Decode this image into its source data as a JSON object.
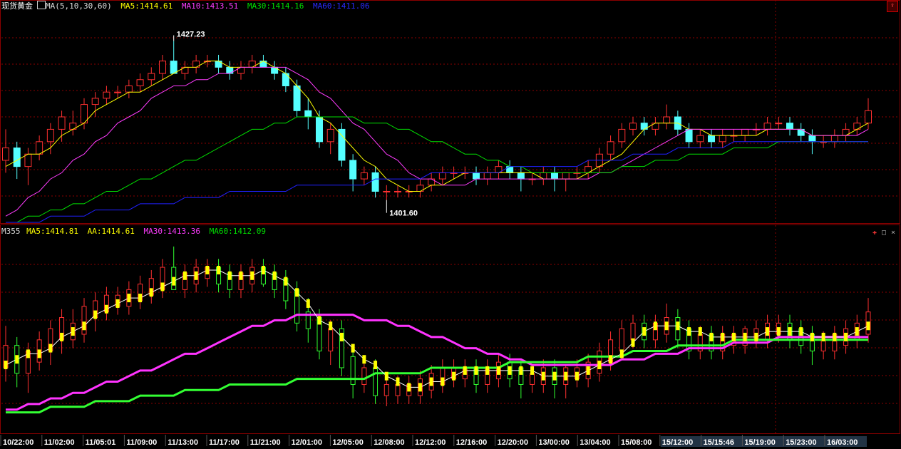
{
  "header_top": {
    "symbol": "现货黄金",
    "indicator": "MA(5,10,30,60)",
    "ma5": "MA5:1414.61",
    "ma10": "MA10:1413.51",
    "ma30": "MA30:1414.16",
    "ma60": "MA60:1411.06"
  },
  "header_bottom": {
    "name": "M355",
    "ma5": "MA5:1414.81",
    "aa": "AA:1414.61",
    "ma30": "MA30:1413.36",
    "ma60": "MA60:1412.09"
  },
  "colors": {
    "up": "#ff3030",
    "down": "#54ffff",
    "ma5": "#ffff00",
    "ma10": "#ff3cff",
    "ma30": "#00e000",
    "ma60": "#2020ff",
    "grid": "#8b0000",
    "axis_text": "#ffffff"
  },
  "chart_data": [
    {
      "type": "candlestick",
      "title": "现货黄金",
      "annotations": [
        {
          "label": "1427.23",
          "kind": "high"
        },
        {
          "label": "1401.60",
          "kind": "low"
        }
      ],
      "ylim": [
        1398,
        1432
      ],
      "grid": true,
      "ohlc_note": "values estimated from chart",
      "ohlc": [
        [
          1408,
          1413,
          1406,
          1410
        ],
        [
          1410,
          1411,
          1405,
          1407
        ],
        [
          1407,
          1410,
          1404,
          1409
        ],
        [
          1409,
          1412,
          1408,
          1411
        ],
        [
          1411,
          1414,
          1409,
          1413
        ],
        [
          1413,
          1416,
          1411,
          1415
        ],
        [
          1413,
          1416,
          1412,
          1414
        ],
        [
          1414,
          1418,
          1413,
          1417
        ],
        [
          1417,
          1419,
          1415,
          1418
        ],
        [
          1418,
          1420,
          1417,
          1419
        ],
        [
          1419,
          1420,
          1418,
          1419
        ],
        [
          1419,
          1421,
          1418,
          1420
        ],
        [
          1420,
          1422,
          1419,
          1421
        ],
        [
          1421,
          1423,
          1420,
          1422
        ],
        [
          1422,
          1425,
          1421,
          1424
        ],
        [
          1424,
          1427.23,
          1423,
          1422
        ],
        [
          1422,
          1424,
          1421,
          1423
        ],
        [
          1423,
          1425,
          1422,
          1424
        ],
        [
          1424,
          1425,
          1423,
          1424
        ],
        [
          1424,
          1425,
          1422,
          1423
        ],
        [
          1423,
          1424,
          1421,
          1422
        ],
        [
          1422,
          1424,
          1421,
          1423
        ],
        [
          1423,
          1425,
          1422,
          1424
        ],
        [
          1424,
          1425,
          1423,
          1423
        ],
        [
          1423,
          1424,
          1421,
          1422
        ],
        [
          1422,
          1423,
          1419,
          1420
        ],
        [
          1420,
          1421,
          1415,
          1416
        ],
        [
          1416,
          1418,
          1413,
          1415
        ],
        [
          1415,
          1416,
          1410,
          1411
        ],
        [
          1411,
          1414,
          1409,
          1413
        ],
        [
          1413,
          1414,
          1407,
          1408
        ],
        [
          1408,
          1409,
          1403,
          1405
        ],
        [
          1405,
          1407,
          1404,
          1406
        ],
        [
          1406,
          1407,
          1402,
          1403
        ],
        [
          1403,
          1404,
          1401.6,
          1403
        ],
        [
          1403,
          1404,
          1402,
          1403
        ],
        [
          1403,
          1404,
          1402,
          1403
        ],
        [
          1403,
          1405,
          1402,
          1404
        ],
        [
          1404,
          1406,
          1403,
          1405
        ],
        [
          1405,
          1407,
          1404,
          1406
        ],
        [
          1406,
          1407,
          1405,
          1406
        ],
        [
          1406,
          1407,
          1405,
          1406
        ],
        [
          1406,
          1407,
          1404,
          1405
        ],
        [
          1405,
          1407,
          1404,
          1406
        ],
        [
          1406,
          1408,
          1405,
          1407
        ],
        [
          1407,
          1408,
          1405,
          1406
        ],
        [
          1406,
          1407,
          1403,
          1405
        ],
        [
          1405,
          1406,
          1404,
          1405
        ],
        [
          1405,
          1407,
          1404,
          1406
        ],
        [
          1406,
          1407,
          1403,
          1405
        ],
        [
          1405,
          1406,
          1403,
          1406
        ],
        [
          1406,
          1407,
          1405,
          1406
        ],
        [
          1406,
          1408,
          1405,
          1407
        ],
        [
          1407,
          1410,
          1406,
          1409
        ],
        [
          1409,
          1412,
          1408,
          1411
        ],
        [
          1411,
          1414,
          1410,
          1413
        ],
        [
          1413,
          1415,
          1412,
          1414
        ],
        [
          1414,
          1415,
          1412,
          1413
        ],
        [
          1413,
          1415,
          1412,
          1414
        ],
        [
          1414,
          1417,
          1413,
          1415
        ],
        [
          1415,
          1416,
          1412,
          1413
        ],
        [
          1413,
          1414,
          1410,
          1411
        ],
        [
          1411,
          1413,
          1410,
          1412
        ],
        [
          1412,
          1413,
          1410,
          1411
        ],
        [
          1411,
          1413,
          1410,
          1412
        ],
        [
          1412,
          1413,
          1411,
          1412
        ],
        [
          1412,
          1413,
          1411,
          1413
        ],
        [
          1413,
          1414,
          1412,
          1413
        ],
        [
          1413,
          1415,
          1412,
          1414
        ],
        [
          1414,
          1415,
          1413,
          1414
        ],
        [
          1414,
          1415,
          1412,
          1413
        ],
        [
          1413,
          1414,
          1411,
          1412
        ],
        [
          1412,
          1413,
          1409,
          1411
        ],
        [
          1411,
          1412,
          1410,
          1411
        ],
        [
          1411,
          1413,
          1410,
          1412
        ],
        [
          1412,
          1414,
          1411,
          1413
        ],
        [
          1413,
          1415,
          1412,
          1414
        ],
        [
          1414,
          1418,
          1413,
          1416
        ]
      ],
      "ma_series": [
        {
          "name": "MA5",
          "values": [
            1407,
            1408,
            1409,
            1409,
            1410,
            1412,
            1413,
            1414,
            1416,
            1417,
            1418,
            1419,
            1419,
            1420,
            1421,
            1422,
            1423,
            1423,
            1424,
            1424,
            1423,
            1423,
            1423,
            1424,
            1423,
            1422,
            1420,
            1418,
            1415,
            1414,
            1412,
            1410,
            1408,
            1407,
            1405,
            1404,
            1403,
            1403,
            1404,
            1404,
            1405,
            1406,
            1406,
            1406,
            1406,
            1406,
            1406,
            1406,
            1405,
            1405,
            1405,
            1405,
            1406,
            1407,
            1408,
            1409,
            1411,
            1413,
            1414,
            1414,
            1414,
            1413,
            1413,
            1412,
            1412,
            1412,
            1412,
            1412,
            1413,
            1413,
            1413,
            1413,
            1412,
            1412,
            1412,
            1412,
            1413,
            1414
          ]
        },
        {
          "name": "MA10",
          "values": [
            1399,
            1400,
            1402,
            1403,
            1405,
            1406,
            1408,
            1409,
            1411,
            1412,
            1414,
            1415,
            1416,
            1418,
            1419,
            1420,
            1420,
            1421,
            1421,
            1422,
            1422,
            1423,
            1423,
            1423,
            1423,
            1423,
            1422,
            1421,
            1419,
            1418,
            1416,
            1414,
            1413,
            1411,
            1409,
            1408,
            1406,
            1405,
            1405,
            1404,
            1404,
            1404,
            1405,
            1405,
            1405,
            1405,
            1405,
            1405,
            1405,
            1405,
            1405,
            1405,
            1405,
            1406,
            1406,
            1407,
            1408,
            1409,
            1410,
            1411,
            1412,
            1413,
            1413,
            1413,
            1413,
            1413,
            1413,
            1413,
            1413,
            1413,
            1413,
            1413,
            1412,
            1412,
            1412,
            1412,
            1412,
            1413
          ]
        },
        {
          "name": "MA30",
          "values": [
            1398,
            1398,
            1399,
            1399,
            1400,
            1400,
            1401,
            1401,
            1402,
            1403,
            1403,
            1404,
            1405,
            1405,
            1406,
            1407,
            1408,
            1408,
            1409,
            1410,
            1411,
            1412,
            1413,
            1413,
            1414,
            1414,
            1415,
            1415,
            1415,
            1415,
            1415,
            1415,
            1414,
            1414,
            1414,
            1413,
            1413,
            1412,
            1411,
            1411,
            1410,
            1409,
            1409,
            1408,
            1408,
            1407,
            1407,
            1406,
            1406,
            1406,
            1406,
            1406,
            1406,
            1406,
            1406,
            1407,
            1407,
            1407,
            1408,
            1408,
            1408,
            1409,
            1409,
            1409,
            1409,
            1410,
            1410,
            1410,
            1410,
            1411,
            1411,
            1411,
            1411,
            1411,
            1411,
            1411,
            1411,
            1411
          ]
        },
        {
          "name": "MA60",
          "values": [
            1398,
            1398,
            1398,
            1398,
            1399,
            1399,
            1399,
            1399,
            1400,
            1400,
            1400,
            1400,
            1401,
            1401,
            1401,
            1401,
            1402,
            1402,
            1402,
            1402,
            1403,
            1403,
            1403,
            1403,
            1403,
            1403,
            1404,
            1404,
            1404,
            1404,
            1404,
            1404,
            1404,
            1405,
            1405,
            1405,
            1405,
            1405,
            1406,
            1406,
            1406,
            1406,
            1406,
            1406,
            1406,
            1407,
            1407,
            1407,
            1407,
            1407,
            1407,
            1407,
            1408,
            1408,
            1408,
            1408,
            1409,
            1409,
            1409,
            1409,
            1410,
            1410,
            1410,
            1410,
            1410,
            1411,
            1411,
            1411,
            1411,
            1411,
            1411,
            1411,
            1411,
            1411,
            1411,
            1411,
            1411,
            1411
          ]
        }
      ]
    },
    {
      "type": "candlestick",
      "title": "M355",
      "grid": true,
      "x_ticks": [
        "10/22:00",
        "11/02:00",
        "11/05:01",
        "11/09:00",
        "11/13:00",
        "11/17:00",
        "11/21:00",
        "12/01:00",
        "12/05:00",
        "12/08:00",
        "12/12:00",
        "12/16:00",
        "12/20:00",
        "13/00:00",
        "13/04:00",
        "15/08:00",
        "15/12:00",
        "15/15:46",
        "15/19:00",
        "15/23:00",
        "16/03:00"
      ],
      "ylim": [
        1395,
        1430
      ]
    }
  ]
}
